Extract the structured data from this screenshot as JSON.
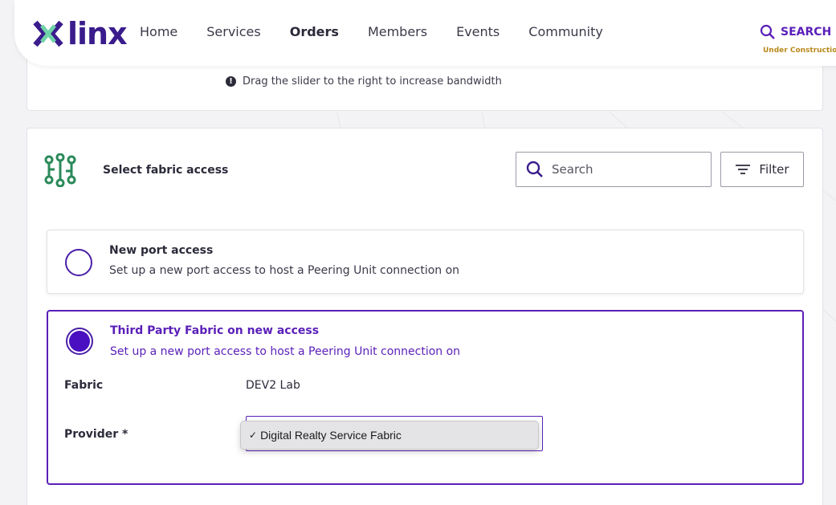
{
  "brand": {
    "logo_text": "linx"
  },
  "nav": {
    "items": [
      {
        "label": "Home"
      },
      {
        "label": "Services"
      },
      {
        "label": "Orders"
      },
      {
        "label": "Members"
      },
      {
        "label": "Events"
      },
      {
        "label": "Community"
      }
    ],
    "active": "Orders",
    "search_label": "SEARCH",
    "under_construction": "Under Construction"
  },
  "bandwidth": {
    "info_text": "Drag the slider to the right to increase bandwidth"
  },
  "fabric_access": {
    "title": "Select fabric access",
    "search_placeholder": "Search",
    "filter_label": "Filter",
    "options": [
      {
        "title": "New port access",
        "description": "Set up a new port access to host a Peering Unit connection on",
        "selected": false
      },
      {
        "title": "Third Party Fabric on new access",
        "description": "Set up a new port access to host a Peering Unit connection on",
        "selected": true
      }
    ],
    "fabric_label": "Fabric",
    "fabric_value": "DEV2 Lab",
    "provider_label": "Provider *",
    "provider_selected": "Digital Realty Service Fabric",
    "provider_check": "✓"
  },
  "colors": {
    "brand_purple": "#5a1fb8",
    "logo_green": "#6fd3a8",
    "logo_navy": "#3a1c8c",
    "warning_gold": "#b98a1c"
  }
}
